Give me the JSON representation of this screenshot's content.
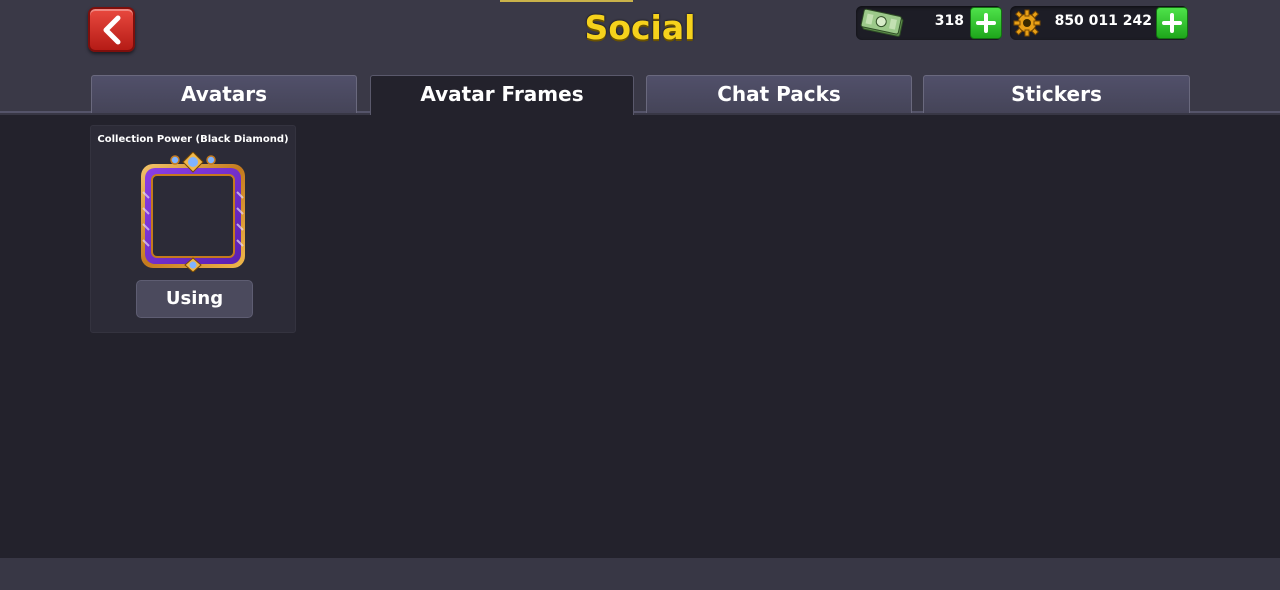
{
  "header": {
    "title": "Social",
    "back_icon": "chevron-left-icon"
  },
  "currencies": [
    {
      "icon": "cash-icon",
      "amount": "318"
    },
    {
      "icon": "coin-gear-icon",
      "amount": "850 011 242"
    }
  ],
  "tabs": [
    {
      "label": "Avatars",
      "active": false
    },
    {
      "label": "Avatar Frames",
      "active": true
    },
    {
      "label": "Chat Packs",
      "active": false
    },
    {
      "label": "Stickers",
      "active": false
    }
  ],
  "frames": [
    {
      "title": "Collection Power (Black Diamond)",
      "status": "Using",
      "icon": "avatar-frame-icon"
    }
  ],
  "colors": {
    "title": "#f6d21c",
    "back_button": "#d8322b",
    "plus_button": "#2fc42b",
    "background": "#23222c"
  }
}
